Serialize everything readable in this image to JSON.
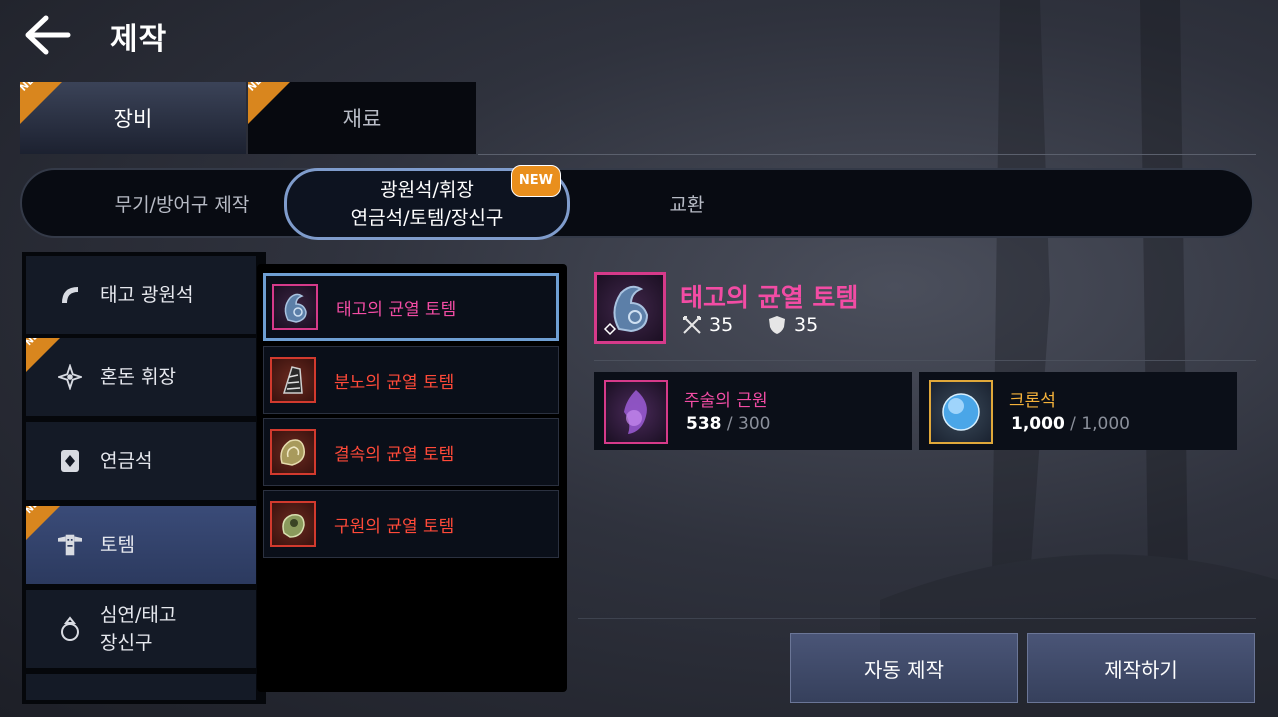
{
  "header": {
    "title": "제작"
  },
  "tabs": [
    {
      "label": "장비",
      "badge": "NEW"
    },
    {
      "label": "재료",
      "badge": "NEW"
    }
  ],
  "subtabs": [
    {
      "label": "무기/방어구 제작"
    },
    {
      "line1": "광원석/휘장",
      "line2": "연금석/토템/장신구",
      "badge": "NEW"
    },
    {
      "label": "교환"
    }
  ],
  "categories": [
    {
      "label": "태고 광원석",
      "icon": "crescent-icon"
    },
    {
      "label": "혼돈 휘장",
      "icon": "emblem-icon",
      "badge": "NEW"
    },
    {
      "label": "연금석",
      "icon": "alchemy-stone-icon"
    },
    {
      "label": "토템",
      "icon": "totem-icon",
      "badge": "NEW"
    },
    {
      "line1": "심연/태고",
      "line2": "장신구",
      "icon": "ring-icon"
    }
  ],
  "items": [
    {
      "name": "태고의 균열 토템",
      "color": "#f24ca4"
    },
    {
      "name": "분노의 균열 토템",
      "color": "#ff4a39"
    },
    {
      "name": "결속의 균열 토템",
      "color": "#ff4a39"
    },
    {
      "name": "구원의 균열 토템",
      "color": "#ff4a39"
    }
  ],
  "detail": {
    "name": "태고의 균열 토템",
    "attack": "35",
    "defense": "35"
  },
  "materials": [
    {
      "name": "주술의 근원",
      "name_color": "#f24ca4",
      "have": "538",
      "sep": " / ",
      "need": "300"
    },
    {
      "name": "크론석",
      "name_color": "#f5b23a",
      "have": "1,000",
      "sep": " / ",
      "need": "1,000"
    }
  ],
  "buttons": {
    "auto": "자동 제작",
    "craft": "제작하기"
  },
  "colors": {
    "accent_pink": "#f24ca4",
    "accent_red": "#ff4a39",
    "new_orange": "#e98f1d",
    "active_border": "#6f9fd3"
  }
}
